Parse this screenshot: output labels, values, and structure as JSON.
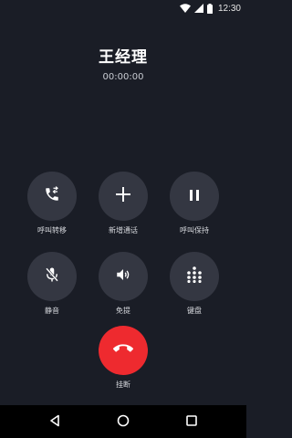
{
  "status_bar": {
    "time": "12:30",
    "icons": [
      "wifi-icon",
      "cell-signal-icon",
      "battery-icon"
    ]
  },
  "call": {
    "caller_name": "王经理",
    "duration": "00:00:00"
  },
  "actions": [
    {
      "id": "transfer",
      "label": "呼叫转移",
      "icon": "call-transfer-icon"
    },
    {
      "id": "add-call",
      "label": "新增通话",
      "icon": "plus-icon"
    },
    {
      "id": "hold",
      "label": "呼叫保持",
      "icon": "pause-icon"
    },
    {
      "id": "mute",
      "label": "静音",
      "icon": "mic-off-icon"
    },
    {
      "id": "speaker",
      "label": "免提",
      "icon": "speaker-icon"
    },
    {
      "id": "keypad",
      "label": "键盘",
      "icon": "dialpad-icon"
    }
  ],
  "hangup": {
    "label": "挂断",
    "icon": "hang-up-icon"
  },
  "nav": {
    "buttons": [
      "back-icon",
      "home-icon",
      "recent-apps-icon"
    ]
  },
  "colors": {
    "background": "#1a1d26",
    "button": "#343742",
    "hangup": "#ee2a2f",
    "text": "#ffffff"
  }
}
